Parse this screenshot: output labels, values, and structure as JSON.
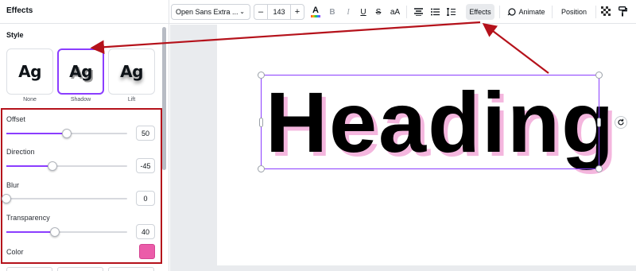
{
  "panel": {
    "title": "Effects",
    "section_label": "Style",
    "styles": [
      {
        "preview": "Ag",
        "caption": "None"
      },
      {
        "preview": "Ag",
        "caption": "Shadow",
        "selected": true
      },
      {
        "preview": "Ag",
        "caption": "Lift"
      }
    ],
    "properties": {
      "offset": {
        "label": "Offset",
        "value": "50",
        "level_percent": 50
      },
      "direction": {
        "label": "Direction",
        "value": "-45",
        "level_percent": 38
      },
      "blur": {
        "label": "Blur",
        "value": "0",
        "level_percent": 0
      },
      "transparency": {
        "label": "Transparency",
        "value": "40",
        "level_percent": 40
      },
      "color": {
        "label": "Color",
        "value": "#eb5ca9"
      }
    }
  },
  "toolbar": {
    "font_name": "Open Sans Extra ...",
    "font_size": "143",
    "decrease_label": "–",
    "increase_label": "+",
    "bold": "B",
    "italic": "I",
    "underline": "U",
    "strikethrough": "S",
    "case": "aA",
    "effects_label": "Effects",
    "animate_label": "Animate",
    "position_label": "Position"
  },
  "canvas": {
    "heading_text": "Heading"
  },
  "colors": {
    "accent": "#8b3dff",
    "annotation": "#b5121b",
    "text_shadow": "#f4b6de"
  }
}
